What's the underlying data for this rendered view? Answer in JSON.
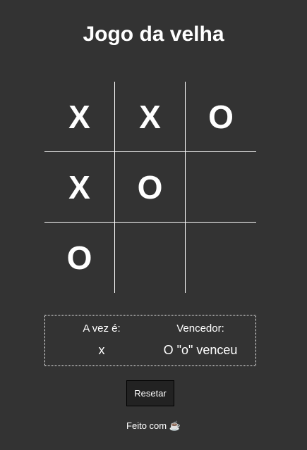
{
  "title": "Jogo da velha",
  "board": [
    [
      "X",
      "X",
      "O"
    ],
    [
      "X",
      "O",
      ""
    ],
    [
      "O",
      "",
      ""
    ]
  ],
  "status": {
    "turn_label": "A vez é:",
    "turn_value": "x",
    "winner_label": "Vencedor:",
    "winner_value": "O \"o\" venceu"
  },
  "reset_label": "Resetar",
  "footer": {
    "text": "Feito com",
    "icon": "☕"
  },
  "colors": {
    "background": "#333333",
    "foreground": "#ffffff"
  }
}
